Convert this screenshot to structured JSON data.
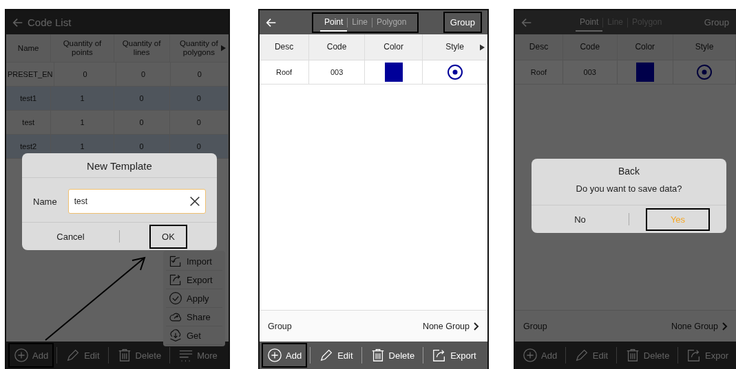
{
  "screens": [
    {
      "kind": "code_list",
      "title": "Code List",
      "columns": [
        "Name",
        "Quantity of points",
        "Quantity of lines",
        "Quantity of polygons"
      ],
      "has_more_columns": true,
      "rows": [
        [
          "PRESET_EN",
          "0",
          "0",
          "0"
        ],
        [
          "test1",
          "1",
          "0",
          "0"
        ],
        [
          "test",
          "1",
          "0",
          "0"
        ],
        [
          "test2",
          "1",
          "0",
          "0"
        ]
      ],
      "menu": [
        {
          "label": "Import",
          "kind": "import"
        },
        {
          "label": "Export",
          "kind": "export"
        },
        {
          "label": "Apply",
          "kind": "apply"
        },
        {
          "label": "Share",
          "kind": "share"
        },
        {
          "label": "Get",
          "kind": "get"
        }
      ],
      "dialog": {
        "kind": "input",
        "title": "New Template",
        "field_label": "Name",
        "field_value": "test",
        "buttons": [
          {
            "label": "Cancel",
            "highlighted": false,
            "accent": false
          },
          {
            "label": "OK",
            "highlighted": true,
            "accent": false
          }
        ]
      },
      "toolbar": [
        {
          "label": "Add",
          "kind": "add",
          "highlighted": true
        },
        {
          "label": "Edit",
          "kind": "edit",
          "highlighted": false
        },
        {
          "label": "Delete",
          "kind": "delete",
          "highlighted": false
        },
        {
          "label": "More",
          "kind": "more",
          "highlighted": false
        }
      ],
      "annotation_arrow": true
    },
    {
      "kind": "code_editor",
      "tabs": [
        {
          "label": "Point",
          "selected": true
        },
        {
          "label": "Line",
          "selected": false
        },
        {
          "label": "Polygon",
          "selected": false
        }
      ],
      "tabs_highlighted": true,
      "group_button": {
        "label": "Group",
        "highlighted": true
      },
      "columns": [
        "Desc",
        "Code",
        "Color",
        "Style"
      ],
      "has_more_columns": true,
      "rows": [
        {
          "desc": "Roof",
          "code": "003",
          "color": "#000099"
        }
      ],
      "group_label": "Group",
      "group_value": "None Group",
      "toolbar": [
        {
          "label": "Add",
          "kind": "add",
          "highlighted": true
        },
        {
          "label": "Edit",
          "kind": "edit",
          "highlighted": false
        },
        {
          "label": "Delete",
          "kind": "delete",
          "highlighted": false
        },
        {
          "label": "Export",
          "kind": "export",
          "highlighted": false
        }
      ]
    },
    {
      "kind": "code_editor",
      "tabs": [
        {
          "label": "Point",
          "selected": true
        },
        {
          "label": "Line",
          "selected": false
        },
        {
          "label": "Polygon",
          "selected": false
        }
      ],
      "tabs_highlighted": false,
      "group_button": {
        "label": "Group",
        "highlighted": false
      },
      "columns": [
        "Desc",
        "Code",
        "Color",
        "Style"
      ],
      "has_more_columns": false,
      "rows": [
        {
          "desc": "Roof",
          "code": "003",
          "color": "#00004a"
        }
      ],
      "group_label": "Group",
      "group_value": "None Group",
      "dialog": {
        "kind": "confirm",
        "title": "Back",
        "message": "Do you want to save data?",
        "buttons": [
          {
            "label": "No",
            "highlighted": false,
            "accent": false
          },
          {
            "label": "Yes",
            "highlighted": true,
            "accent": true
          }
        ]
      },
      "toolbar": [
        {
          "label": "Add",
          "kind": "add",
          "highlighted": false
        },
        {
          "label": "Edit",
          "kind": "edit",
          "highlighted": false
        },
        {
          "label": "Delete",
          "kind": "delete",
          "highlighted": false
        },
        {
          "label": "Expor",
          "kind": "export",
          "highlighted": false
        }
      ]
    }
  ]
}
